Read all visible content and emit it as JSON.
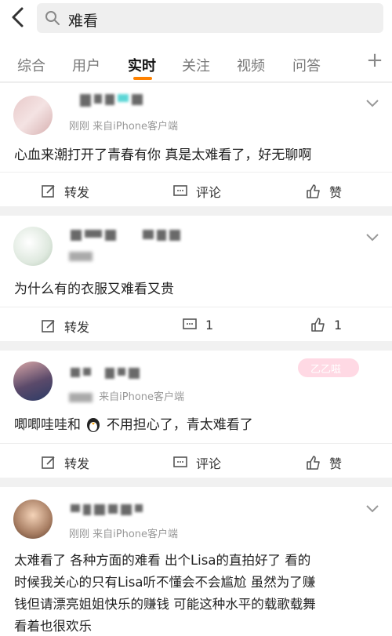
{
  "search": {
    "query": "难看"
  },
  "tabs": [
    {
      "label": "综合"
    },
    {
      "label": "用户"
    },
    {
      "label": "实时"
    },
    {
      "label": "关注"
    },
    {
      "label": "视频"
    },
    {
      "label": "问答"
    }
  ],
  "tabs_plus": "+",
  "posts": [
    {
      "meta_time": "刚刚",
      "meta_source": "来自iPhone客户端",
      "text": "心血来潮打开了青春有你 真是太难看了，好无聊啊",
      "repost": "转发",
      "comment": "评论",
      "like": "赞"
    },
    {
      "meta_time": "",
      "meta_source": "",
      "text": "为什么有的衣服又难看又贵",
      "repost": "转发",
      "comment": "1",
      "like": "1"
    },
    {
      "meta_time": "",
      "meta_source": "来自iPhone客户端",
      "text_before": "唧唧哇哇和",
      "text_after": "不用担心了，青太难看了",
      "repost": "转发",
      "comment": "评论",
      "like": "赞",
      "sticker": "乙乙嗞"
    },
    {
      "meta_time": "刚刚",
      "meta_source": "来自iPhone客户端",
      "lines": [
        "太难看了 各种方面的难看 出个Lisa的直拍好了 看的",
        "时候我关心的只有Lisa听不懂会不会尴尬 虽然为了赚",
        "钱但请漂亮姐姐快乐的赚钱 可能这种水平的载歌载舞",
        "看着也很欢乐"
      ]
    }
  ],
  "colors": {
    "accent": "#ff8200",
    "divider": "#f1f1f1"
  }
}
